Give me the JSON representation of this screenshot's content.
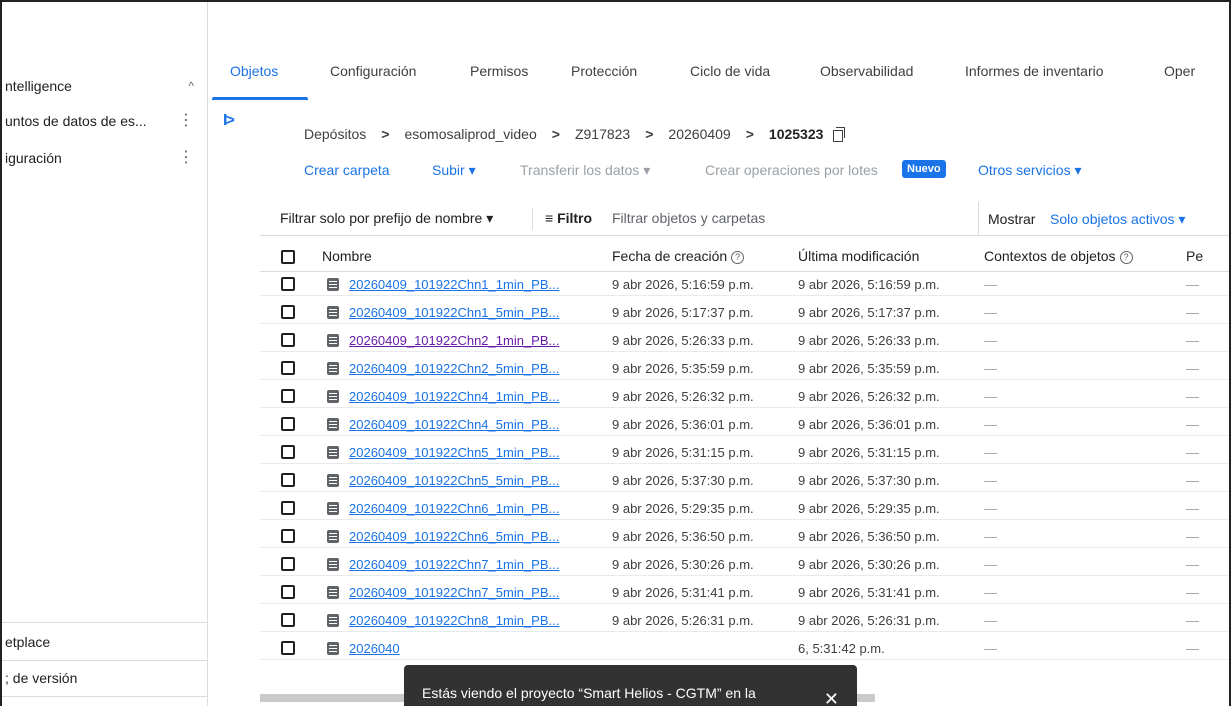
{
  "sidebar": {
    "items": [
      {
        "label": "ntelligence",
        "control": "^"
      },
      {
        "label": "untos de datos de es...",
        "control": "⋮"
      },
      {
        "label": "iguración",
        "control": "⋮"
      }
    ],
    "bottom_items": [
      {
        "label": "etplace"
      },
      {
        "label": "; de versión"
      }
    ]
  },
  "rail": {
    "toggle": "I>"
  },
  "tabs": [
    "Objetos",
    "Configuración",
    "Permisos",
    "Protección",
    "Ciclo de vida",
    "Observabilidad",
    "Informes de inventario",
    "Oper"
  ],
  "breadcrumb": [
    "Depósitos",
    "esomosaliprod_video",
    "Z917823",
    "20260409",
    "1025323"
  ],
  "breadcrumb_sep": ">",
  "actions": {
    "create_folder": "Crear carpeta",
    "upload": "Subir ▾",
    "transfer": "Transferir los datos ▾",
    "batch": "Crear operaciones por lotes",
    "new_badge": "Nuevo",
    "other": "Otros servicios ▾"
  },
  "filter": {
    "prefix": "Filtrar solo por prefijo de nombre ▾",
    "filter_icon": "≡",
    "filter_label": "Filtro",
    "placeholder": "Filtrar objetos y carpetas",
    "show_label": "Mostrar",
    "show_value": "Solo objetos activos ▾"
  },
  "table": {
    "columns": {
      "name": "Nombre",
      "created": "Fecha de creación",
      "help": "?",
      "modified": "Última modificación",
      "contexts": "Contextos de objetos",
      "last": "Pe"
    },
    "rows": [
      {
        "name": "20260409_101922Chn1_1min_PB...",
        "created": "9 abr 2026, 5:16:59 p.m.",
        "modified": "9 abr 2026, 5:16:59 p.m.",
        "ctx": "—",
        "last": "—",
        "visited": false
      },
      {
        "name": "20260409_101922Chn1_5min_PB...",
        "created": "9 abr 2026, 5:17:37 p.m.",
        "modified": "9 abr 2026, 5:17:37 p.m.",
        "ctx": "—",
        "last": "—",
        "visited": false
      },
      {
        "name": "20260409_101922Chn2_1min_PB...",
        "created": "9 abr 2026, 5:26:33 p.m.",
        "modified": "9 abr 2026, 5:26:33 p.m.",
        "ctx": "—",
        "last": "—",
        "visited": true
      },
      {
        "name": "20260409_101922Chn2_5min_PB...",
        "created": "9 abr 2026, 5:35:59 p.m.",
        "modified": "9 abr 2026, 5:35:59 p.m.",
        "ctx": "—",
        "last": "—",
        "visited": false
      },
      {
        "name": "20260409_101922Chn4_1min_PB...",
        "created": "9 abr 2026, 5:26:32 p.m.",
        "modified": "9 abr 2026, 5:26:32 p.m.",
        "ctx": "—",
        "last": "—",
        "visited": false
      },
      {
        "name": "20260409_101922Chn4_5min_PB...",
        "created": "9 abr 2026, 5:36:01 p.m.",
        "modified": "9 abr 2026, 5:36:01 p.m.",
        "ctx": "—",
        "last": "—",
        "visited": false
      },
      {
        "name": "20260409_101922Chn5_1min_PB...",
        "created": "9 abr 2026, 5:31:15 p.m.",
        "modified": "9 abr 2026, 5:31:15 p.m.",
        "ctx": "—",
        "last": "—",
        "visited": false
      },
      {
        "name": "20260409_101922Chn5_5min_PB...",
        "created": "9 abr 2026, 5:37:30 p.m.",
        "modified": "9 abr 2026, 5:37:30 p.m.",
        "ctx": "—",
        "last": "—",
        "visited": false
      },
      {
        "name": "20260409_101922Chn6_1min_PB...",
        "created": "9 abr 2026, 5:29:35 p.m.",
        "modified": "9 abr 2026, 5:29:35 p.m.",
        "ctx": "—",
        "last": "—",
        "visited": false
      },
      {
        "name": "20260409_101922Chn6_5min_PB...",
        "created": "9 abr 2026, 5:36:50 p.m.",
        "modified": "9 abr 2026, 5:36:50 p.m.",
        "ctx": "—",
        "last": "—",
        "visited": false
      },
      {
        "name": "20260409_101922Chn7_1min_PB...",
        "created": "9 abr 2026, 5:30:26 p.m.",
        "modified": "9 abr 2026, 5:30:26 p.m.",
        "ctx": "—",
        "last": "—",
        "visited": false
      },
      {
        "name": "20260409_101922Chn7_5min_PB...",
        "created": "9 abr 2026, 5:31:41 p.m.",
        "modified": "9 abr 2026, 5:31:41 p.m.",
        "ctx": "—",
        "last": "—",
        "visited": false
      },
      {
        "name": "20260409_101922Chn8_1min_PB...",
        "created": "9 abr 2026, 5:26:31 p.m.",
        "modified": "9 abr 2026, 5:26:31 p.m.",
        "ctx": "—",
        "last": "—",
        "visited": false
      },
      {
        "name": "2026040",
        "created": "",
        "modified": "6, 5:31:42 p.m.",
        "ctx": "—",
        "last": "—",
        "visited": false
      }
    ]
  },
  "snackbar": {
    "text": "Estás viendo el proyecto “Smart Helios - CGTM” en la",
    "close": "✕"
  },
  "colors": {
    "accent": "#1a73e8",
    "visited": "#681da8",
    "snackbar": "#323232"
  }
}
